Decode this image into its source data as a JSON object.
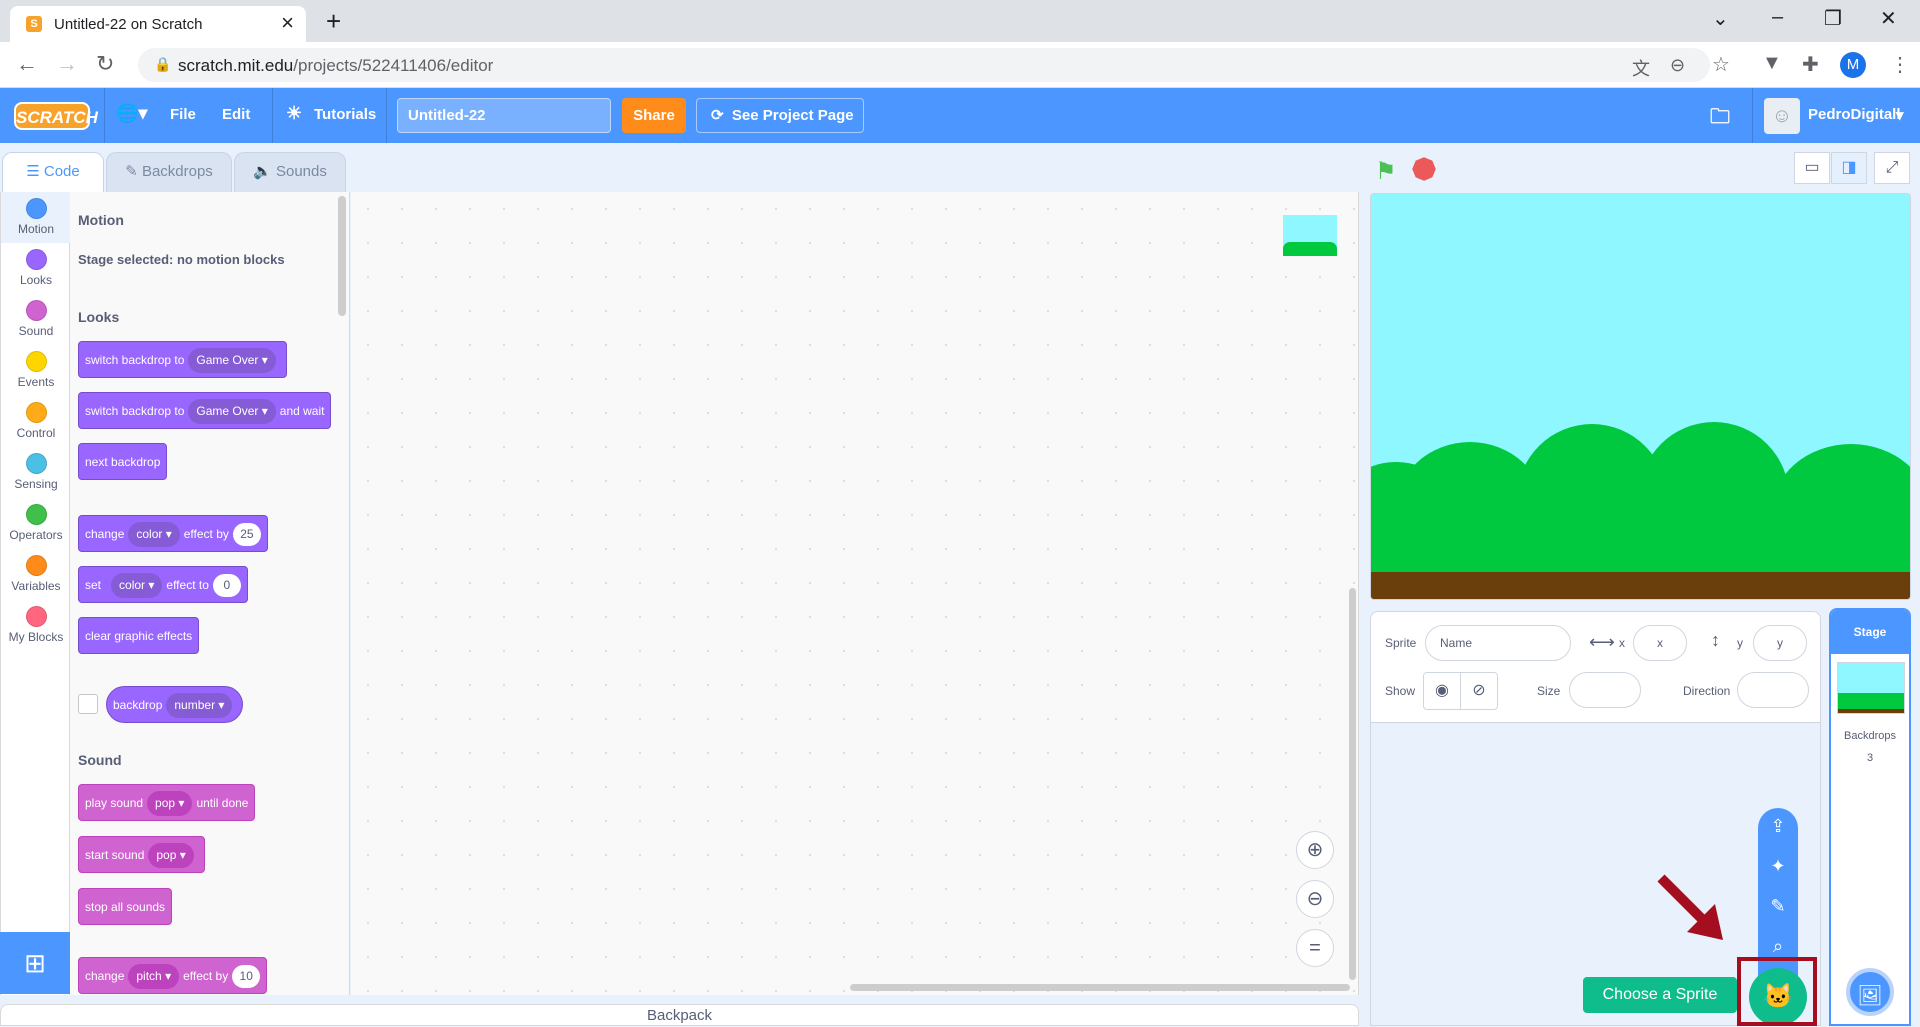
{
  "browser": {
    "tab_title": "Untitled-22 on Scratch",
    "tab_favicon": "S",
    "url_domain": "scratch.mit.edu",
    "url_path": "/projects/522411406/editor",
    "profile_initial": "M"
  },
  "menubar": {
    "logo_text": "SCRATCH",
    "file": "File",
    "edit": "Edit",
    "tutorials": "Tutorials",
    "project_title": "Untitled-22",
    "share": "Share",
    "see_project_page": "See Project Page",
    "username": "PedroDigitall"
  },
  "editor_tabs": {
    "code": "Code",
    "backdrops": "Backdrops",
    "sounds": "Sounds"
  },
  "categories": [
    {
      "label": "Motion",
      "color": "#4c97ff"
    },
    {
      "label": "Looks",
      "color": "#9966ff"
    },
    {
      "label": "Sound",
      "color": "#cf63cf"
    },
    {
      "label": "Events",
      "color": "#ffd500"
    },
    {
      "label": "Control",
      "color": "#ffab19"
    },
    {
      "label": "Sensing",
      "color": "#4cbfe6"
    },
    {
      "label": "Operators",
      "color": "#40bf4a"
    },
    {
      "label": "Variables",
      "color": "#ff8c1a"
    },
    {
      "label": "My Blocks",
      "color": "#ff6680"
    }
  ],
  "palette": {
    "motion_header": "Motion",
    "motion_note": "Stage selected: no motion blocks",
    "looks_header": "Looks",
    "sound_header": "Sound",
    "blocks": {
      "switch_backdrop": {
        "text": "switch backdrop to",
        "dd": "Game Over"
      },
      "switch_backdrop_wait": {
        "text": "switch backdrop to",
        "dd": "Game Over",
        "suffix": "and wait"
      },
      "next_backdrop": {
        "text": "next backdrop"
      },
      "change_effect": {
        "text": "change",
        "dd": "color",
        "mid": "effect by",
        "num": "25"
      },
      "set_effect": {
        "text": "set",
        "dd": "color",
        "mid": "effect to",
        "num": "0"
      },
      "clear_effects": {
        "text": "clear graphic effects"
      },
      "backdrop_reporter": {
        "text": "backdrop",
        "dd": "number"
      },
      "play_sound": {
        "text": "play sound",
        "dd": "pop",
        "suffix": "until done"
      },
      "start_sound": {
        "text": "start sound",
        "dd": "pop"
      },
      "stop_sounds": {
        "text": "stop all sounds"
      },
      "change_pitch": {
        "text": "change",
        "dd": "pitch",
        "mid": "effect by",
        "num": "10"
      }
    }
  },
  "backpack": "Backpack",
  "sprite_info": {
    "sprite_label": "Sprite",
    "name_placeholder": "Name",
    "x_label": "x",
    "x_placeholder": "x",
    "y_label": "y",
    "y_placeholder": "y",
    "show_label": "Show",
    "size_label": "Size",
    "direction_label": "Direction"
  },
  "sprite_menu": {
    "choose_sprite": "Choose a Sprite"
  },
  "stage_pane": {
    "header": "Stage",
    "backdrops_label": "Backdrops",
    "backdrops_count": "3"
  }
}
